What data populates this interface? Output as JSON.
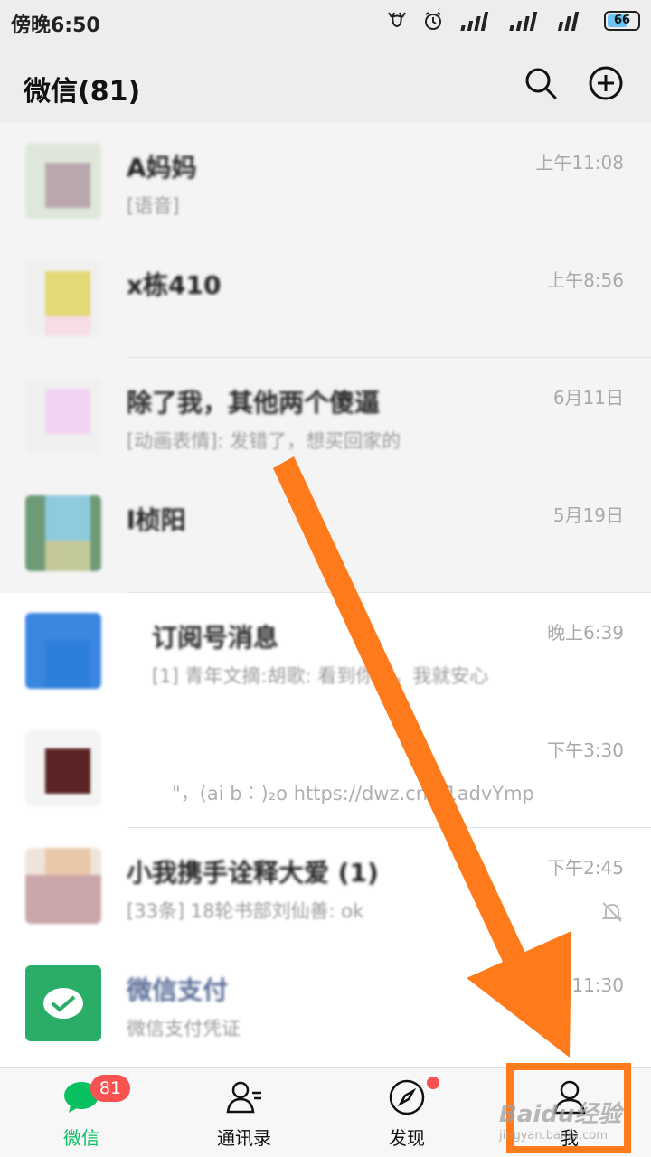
{
  "status_bar": {
    "time": "傍晚6:50",
    "battery": "66"
  },
  "header": {
    "title": "微信(81)"
  },
  "chats": [
    {
      "name": "A妈妈",
      "preview": "[语音]",
      "time": "上午11:08"
    },
    {
      "name": "x栋410",
      "preview": "",
      "time": "上午8:56"
    },
    {
      "name": "除了我，其他两个傻逼",
      "preview": "[动画表情]: 发错了，想买回家的",
      "time": "6月11日"
    },
    {
      "name": "l桢阳",
      "preview": "",
      "time": "5月19日"
    },
    {
      "name": "订阅号消息",
      "preview": "[1] 青年文摘:胡歌: 看到你们，我就安心",
      "time": "晚上6:39"
    },
    {
      "name": "",
      "preview": "\"，(ai b︰)₂o  https://dwz.cn/k1advYmp",
      "time": "下午3:30"
    },
    {
      "name": "小我携手诠释大爱 (1)",
      "preview": "[33条] 18轮书部刘仙善: ok",
      "time": "下午2:45"
    },
    {
      "name": "微信支付",
      "preview": "微信支付凭证",
      "time": "上午11:30"
    }
  ],
  "tabs": [
    {
      "label": "微信",
      "badge": "81"
    },
    {
      "label": "通讯录"
    },
    {
      "label": "发现"
    },
    {
      "label": "我"
    }
  ],
  "watermark": {
    "main": "Baidu经验",
    "sub": "jingyan.baidu.com"
  },
  "colors": {
    "accent": "#07c160",
    "badge": "#fa5151",
    "annotation": "#ff7a1a",
    "header_bg": "#ededed"
  }
}
